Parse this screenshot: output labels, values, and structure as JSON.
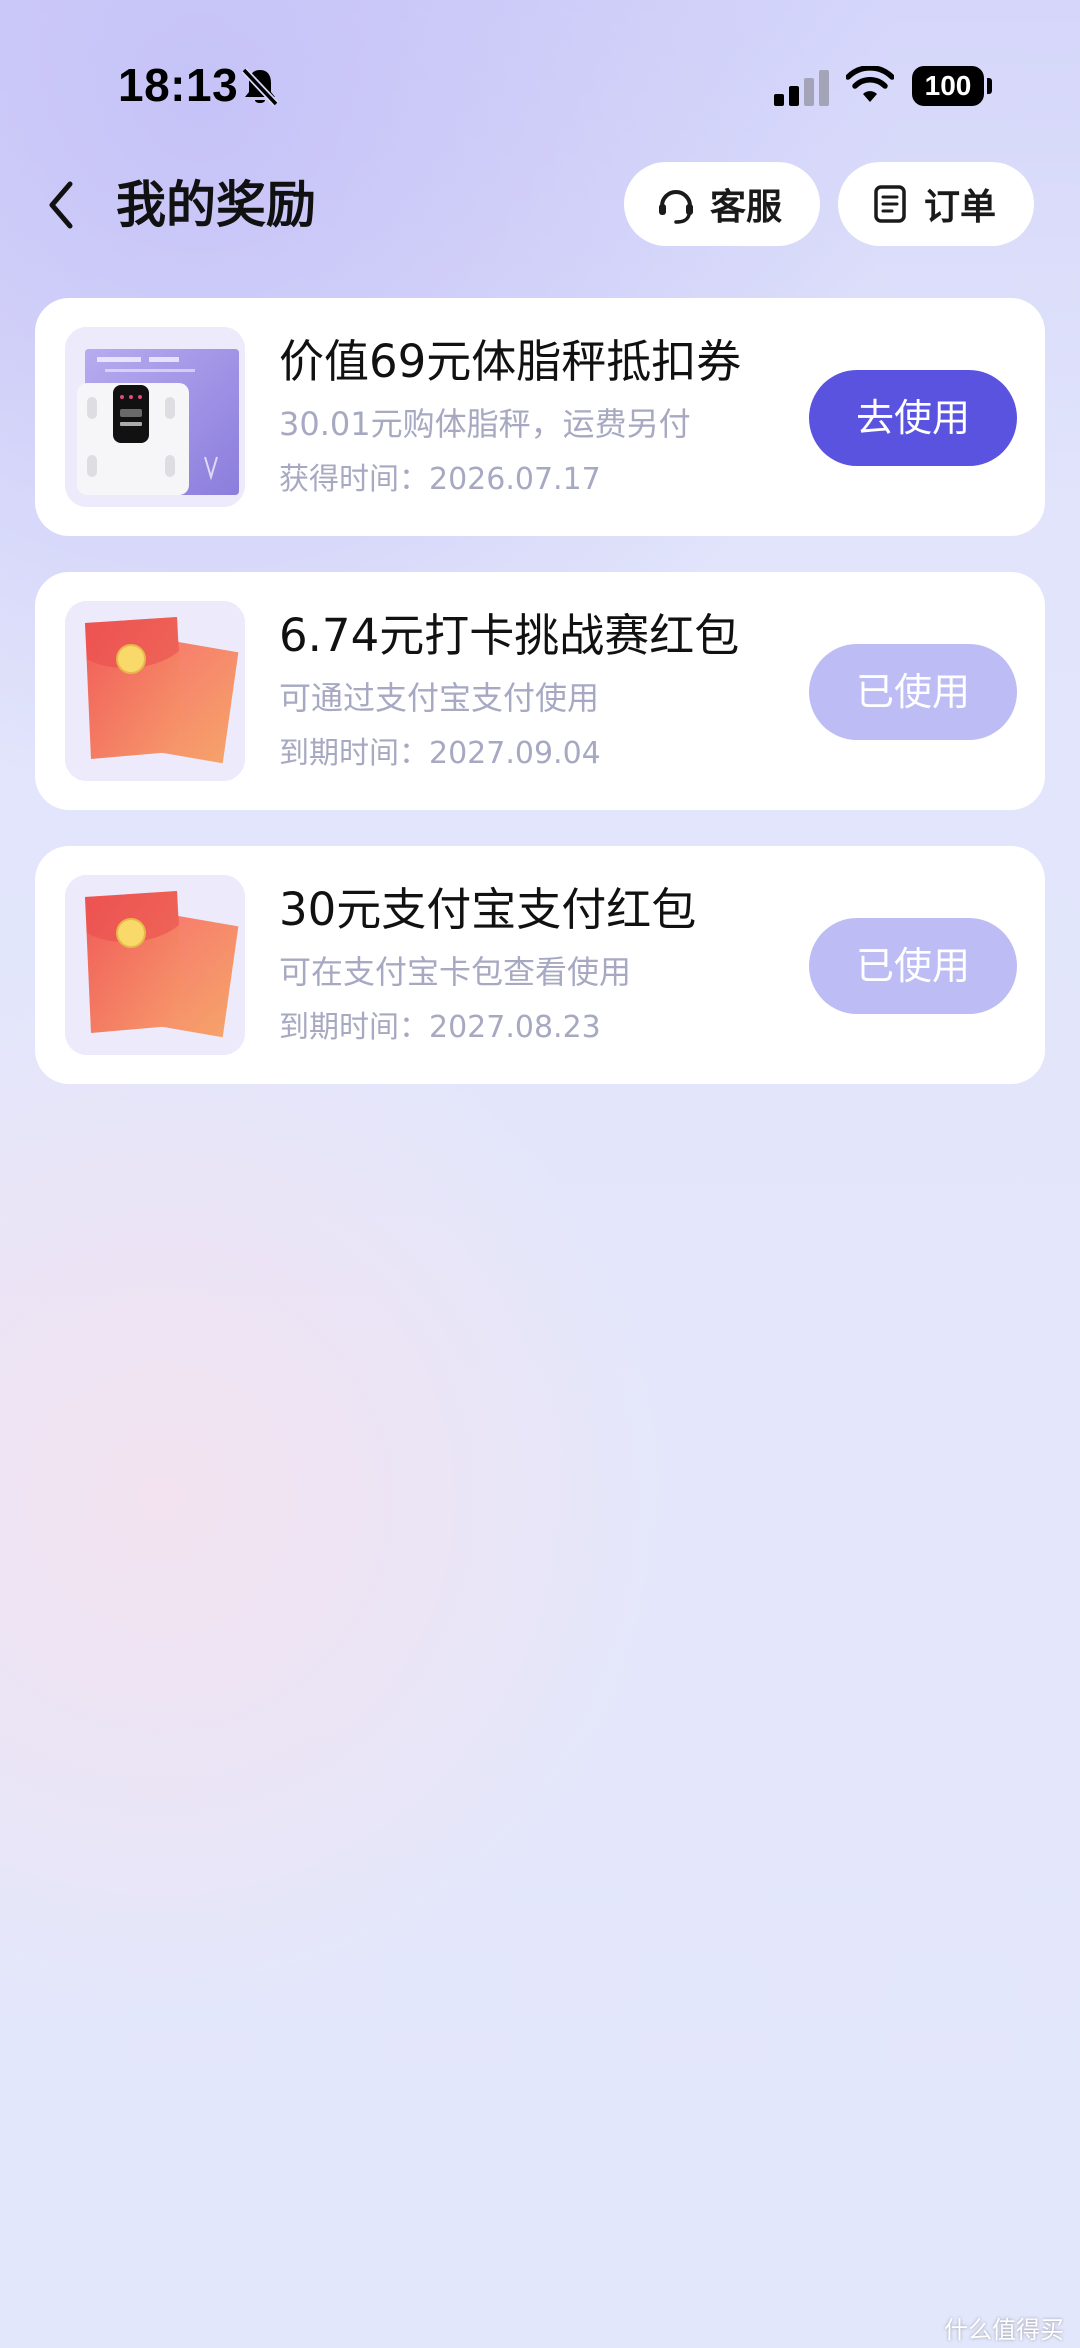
{
  "status_bar": {
    "time": "18:13",
    "battery": "100",
    "icons": [
      "bell-muted-icon",
      "signal-icon",
      "wifi-icon",
      "battery-icon"
    ]
  },
  "header": {
    "title": "我的奖励",
    "back_icon": "chevron-left-icon",
    "service_label": "客服",
    "service_icon": "headset-icon",
    "order_label": "订单",
    "order_icon": "document-icon"
  },
  "rewards": [
    {
      "title": "价值69元体脂秤抵扣券",
      "desc": "30.01元购体脂秤，运费另付",
      "date": "获得时间：2026.07.17",
      "button": "去使用",
      "state": "active",
      "thumb": "body-fat-scale-image"
    },
    {
      "title": "6.74元打卡挑战赛红包",
      "desc": "可通过支付宝支付使用",
      "date": "到期时间：2027.09.04",
      "button": "已使用",
      "state": "used",
      "thumb": "red-envelope-image"
    },
    {
      "title": "30元支付宝支付红包",
      "desc": "可在支付宝卡包查看使用",
      "date": "到期时间：2027.08.23",
      "button": "已使用",
      "state": "used",
      "thumb": "red-envelope-image"
    }
  ],
  "watermark": "什么值得买",
  "colors": {
    "primary_button": "#5a53e0",
    "used_button": "#bdbcf4",
    "secondary_text": "#a7a9c2",
    "envelope_red": "#f25a54",
    "envelope_seal": "#f8d96a"
  }
}
